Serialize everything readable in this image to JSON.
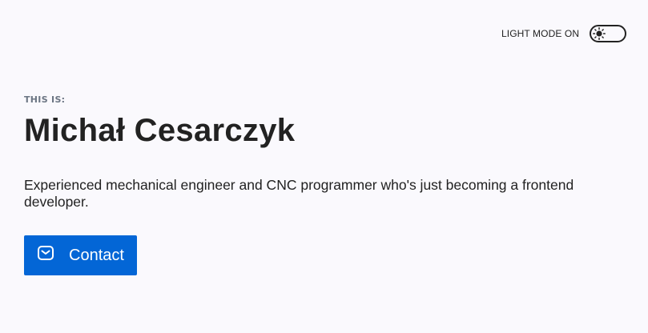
{
  "theme_toggle": {
    "label": "LIGHT MODE ON",
    "state": "light",
    "icon": "sun-icon"
  },
  "hero": {
    "eyebrow": "THIS IS:",
    "name": "Michał Cesarczyk",
    "tagline": "Experienced mechanical engineer and CNC programmer who's just becoming a frontend developer.",
    "contact_button": {
      "label": "Contact",
      "icon": "mail-icon"
    }
  },
  "colors": {
    "background": "#faf9fd",
    "text": "#222222",
    "eyebrow": "#6b7583",
    "accent": "#0366d6"
  }
}
